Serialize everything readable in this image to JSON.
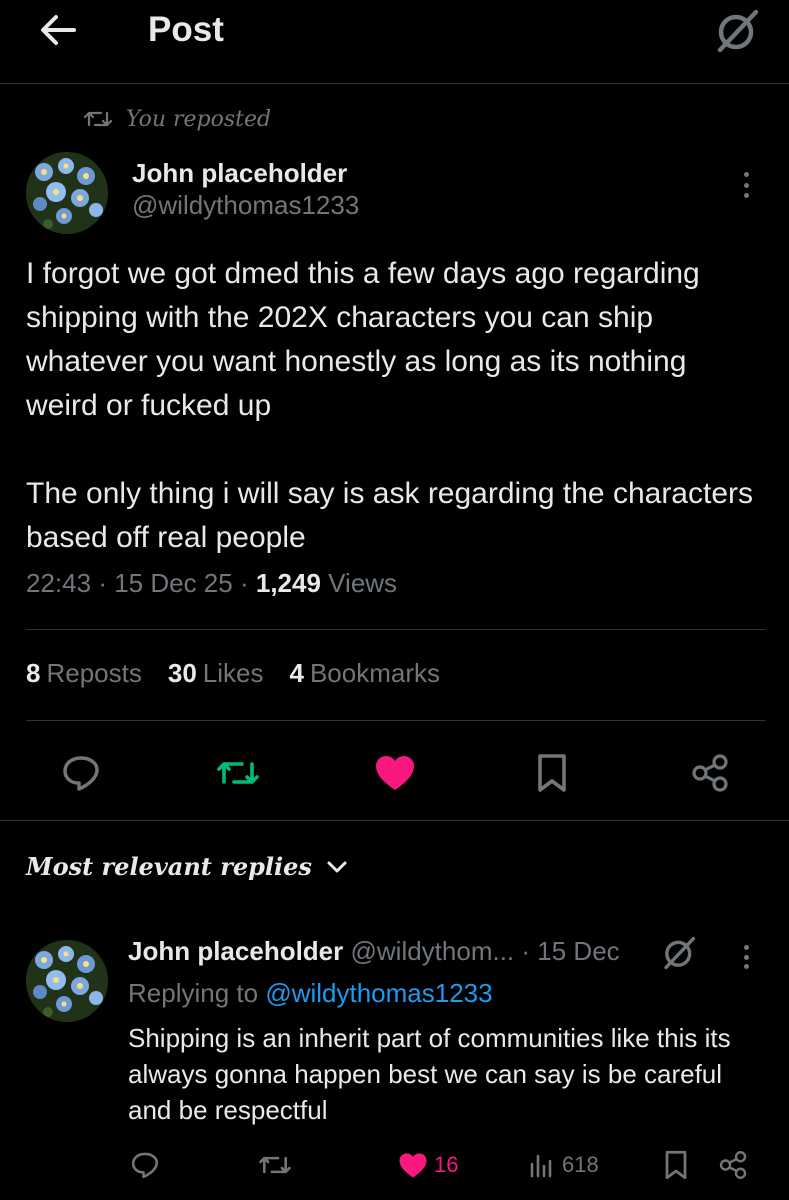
{
  "header": {
    "title": "Post"
  },
  "repost": {
    "label": "You reposted"
  },
  "post": {
    "author_name": "John placeholder",
    "author_handle": "@wildythomas1233",
    "paragraphs": [
      "I forgot we got dmed this a few days ago regarding shipping with the 202X characters you can ship whatever you want honestly as long as its nothing weird or fucked up",
      "The only thing i will say is ask regarding the characters based off real people"
    ],
    "time": "22:43",
    "date": "15 Dec 25",
    "views_count": "1,249",
    "views_label": "Views"
  },
  "stats": {
    "reposts_count": "8",
    "reposts_label": "Reposts",
    "likes_count": "30",
    "likes_label": "Likes",
    "bookmarks_count": "4",
    "bookmarks_label": "Bookmarks"
  },
  "replies_filter": {
    "label": "Most relevant replies"
  },
  "reply": {
    "author_name": "John placeholder",
    "author_handle": "@wildythom...",
    "date": "· 15 Dec",
    "replying_prefix": "Replying to",
    "replying_handle": "@wildythomas1233",
    "text": "Shipping is an inherit part of communities like this its always gonna happen best we can say is be careful and be respectful",
    "likes": "16",
    "views": "618"
  },
  "colors": {
    "background": "#000000",
    "primary_text": "#e7e9ea",
    "secondary_text": "#71767b",
    "divider": "#2f3336",
    "repost_active": "#00ba7c",
    "like_active": "#f91880",
    "link": "#1d9bf0"
  },
  "icons": {
    "back": "arrow-left-icon",
    "grok": "grok-icon",
    "repost": "repost-icon",
    "more": "more-dots-icon",
    "reply": "reply-icon",
    "like": "heart-icon",
    "bookmark": "bookmark-icon",
    "share": "share-icon",
    "views": "views-chart-icon",
    "chevron": "chevron-down-icon"
  }
}
